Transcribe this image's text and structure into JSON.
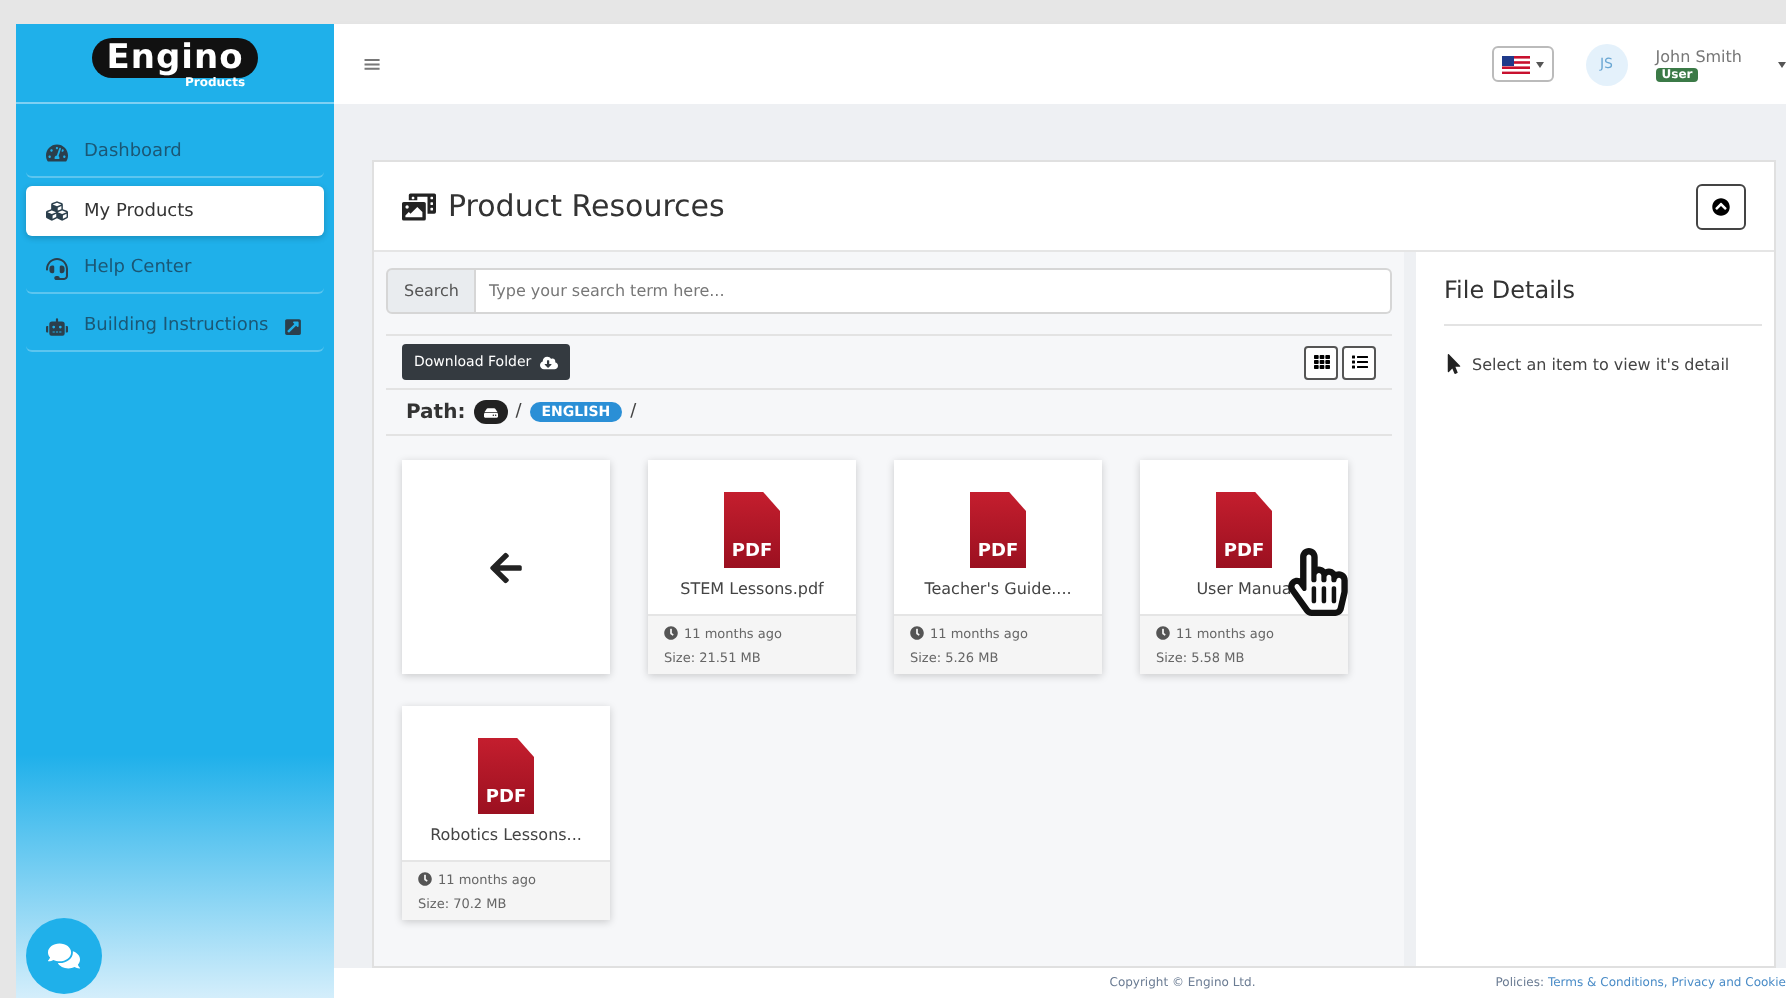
{
  "sidebar": {
    "logo": {
      "wordmark": "Engino",
      "tagline": "Products"
    },
    "items": [
      {
        "label": "Dashboard",
        "kind": "dashboard",
        "selected": false,
        "external": false
      },
      {
        "label": "My Products",
        "kind": "products",
        "selected": true,
        "external": false
      },
      {
        "label": "Help Center",
        "kind": "help",
        "selected": false,
        "external": false
      },
      {
        "label": "Building Instructions",
        "kind": "robot",
        "selected": false,
        "external": true
      }
    ]
  },
  "topbar": {
    "menu": "≡",
    "user": {
      "initials": "JS",
      "name": "John Smith",
      "role": "User"
    }
  },
  "card": {
    "title": "Product Resources",
    "search": {
      "label": "Search",
      "placeholder": "Type your search term here..."
    },
    "download": "Download Folder",
    "views": [
      {
        "kind": "grid"
      },
      {
        "kind": "list"
      }
    ],
    "path": {
      "label": "Path:",
      "crumbs": [
        {
          "kind": "root",
          "separator": "/"
        },
        {
          "kind": "folder",
          "label": "ENGLISH",
          "separator": "/"
        }
      ]
    },
    "files": [
      {
        "kind": "back"
      },
      {
        "kind": "pdf",
        "badge": "PDF",
        "name": "STEM Lessons.pdf",
        "modified": "11 months ago",
        "size": "Size: 21.51 MB",
        "hovered": false
      },
      {
        "kind": "pdf",
        "badge": "PDF",
        "name": "Teacher's Guide....",
        "modified": "11 months ago",
        "size": "Size: 5.26 MB",
        "hovered": false
      },
      {
        "kind": "pdf",
        "badge": "PDF",
        "name": "User Manua",
        "modified": "11 months ago",
        "size": "Size: 5.58 MB",
        "hovered": true
      },
      {
        "kind": "pdf",
        "badge": "PDF",
        "name": "Robotics Lessons...",
        "modified": "11 months ago",
        "size": "Size: 70.2 MB",
        "hovered": false
      }
    ],
    "details": {
      "title": "File Details",
      "hint": "Select an item to view it's detail"
    }
  },
  "footer": {
    "copyright": "Copyright © Engino Ltd.",
    "policies": "Policies:",
    "links": [
      "Terms & Conditions,",
      "Privacy and Cookie"
    ]
  }
}
